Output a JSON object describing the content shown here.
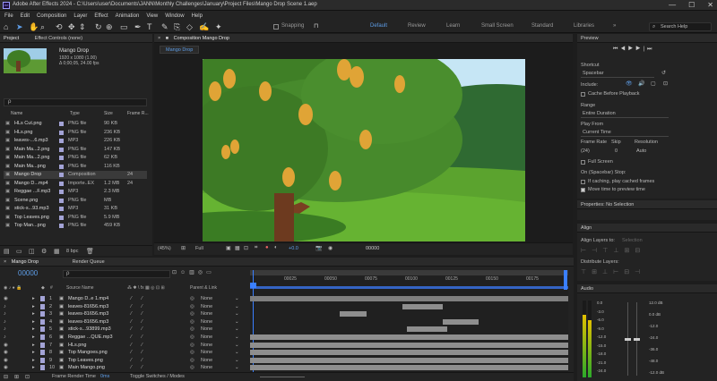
{
  "window": {
    "title": "Adobe After Effects 2024 - C:\\Users\\user\\Documents\\JANN\\Monthly Challenges\\January\\Project Files\\Mango Drop Scene 1.aep"
  },
  "menu": [
    "File",
    "Edit",
    "Composition",
    "Layer",
    "Effect",
    "Animation",
    "View",
    "Window",
    "Help"
  ],
  "toolbar": {
    "snapping": "Snapping",
    "workspaces": [
      "Default",
      "Review",
      "Learn",
      "Small Screen",
      "Standard",
      "Libraries"
    ],
    "active_workspace": "Default",
    "search_placeholder": "Search Help"
  },
  "project": {
    "tabs": [
      "Project",
      "Effect Controls (none)"
    ],
    "preview_name": "Mango Drop",
    "preview_info1": "1920 x 1080 (1.00)",
    "preview_info2": "Δ 0;00;05, 24.00 fps",
    "search_placeholder": "ρ",
    "columns": [
      "Name",
      "Type",
      "Size",
      "Frame R..."
    ],
    "items": [
      {
        "name": "HLs Cut.png",
        "type": "PNG file",
        "size": "90 KB",
        "fr": "",
        "color": "#a3a3d6"
      },
      {
        "name": "HLs.png",
        "type": "PNG file",
        "size": "236 KB",
        "fr": "",
        "color": "#a3a3d6"
      },
      {
        "name": "leaves-...6.mp3",
        "type": "MP3",
        "size": "226 KB",
        "fr": "",
        "color": "#a3a3d6"
      },
      {
        "name": "Main Ma...2.png",
        "type": "PNG file",
        "size": "147 KB",
        "fr": "",
        "color": "#a3a3d6"
      },
      {
        "name": "Main Ma...2.png",
        "type": "PNG file",
        "size": "62 KB",
        "fr": "",
        "color": "#a3a3d6"
      },
      {
        "name": "Main Ma...png",
        "type": "PNG file",
        "size": "116 KB",
        "fr": "",
        "color": "#a3a3d6"
      },
      {
        "name": "Mango Drop",
        "type": "Composition",
        "size": "",
        "fr": "24",
        "color": "#a3a3d6"
      },
      {
        "name": "Mango D...mp4",
        "type": "Importe..EX",
        "size": "1.2 MB",
        "fr": "24",
        "color": "#a3a3d6"
      },
      {
        "name": "Reggae ...F.mp3",
        "type": "MP3",
        "size": "2.3 MB",
        "fr": "",
        "color": "#a3a3d6"
      },
      {
        "name": "Scene.png",
        "type": "PNG file",
        "size": "MB",
        "fr": "",
        "color": "#a3a3d6"
      },
      {
        "name": "stick-s...93.mp3",
        "type": "MP3",
        "size": "31 KB",
        "fr": "",
        "color": "#a3a3d6"
      },
      {
        "name": "Top Leaves.png",
        "type": "PNG file",
        "size": "5.9 MB",
        "fr": "",
        "color": "#a3a3d6"
      },
      {
        "name": "Top Man...png",
        "type": "PNG file",
        "size": "459 KB",
        "fr": "",
        "color": "#a3a3d6"
      }
    ],
    "bpc": "8 bpc"
  },
  "composition": {
    "tab_label": "Composition Mango Drop",
    "subtab": "Mango Drop",
    "zoom": "(45%)",
    "resolution": "Full",
    "exposure": "+0.0",
    "timecode": "00000"
  },
  "timeline": {
    "tabs": [
      "Mango Drop",
      "Render Queue"
    ],
    "current_time": "00000",
    "col_source": "Source Name",
    "col_parent": "Parent & Link",
    "ruler": [
      "00025",
      "00050",
      "00075",
      "00100",
      "00125",
      "00150",
      "00175"
    ],
    "layers": [
      {
        "num": "1",
        "name": "Mango D..e 1.mp4",
        "parent": "None",
        "color": "#a3a3d6"
      },
      {
        "num": "2",
        "name": "leaves-81656.mp3",
        "parent": "None",
        "color": "#a3a3d6"
      },
      {
        "num": "3",
        "name": "leaves-81656.mp3",
        "parent": "None",
        "color": "#a3a3d6"
      },
      {
        "num": "4",
        "name": "leaves-81656.mp3",
        "parent": "None",
        "color": "#a3a3d6"
      },
      {
        "num": "5",
        "name": "stick-s...93899.mp3",
        "parent": "None",
        "color": "#a3a3d6"
      },
      {
        "num": "6",
        "name": "Reggae ...QUE.mp3",
        "parent": "None",
        "color": "#a3a3d6"
      },
      {
        "num": "7",
        "name": "HLs.png",
        "parent": "None",
        "color": "#a3a3d6"
      },
      {
        "num": "8",
        "name": "Top Mangoes.png",
        "parent": "None",
        "color": "#a3a3d6"
      },
      {
        "num": "9",
        "name": "Top Leaves.png",
        "parent": "None",
        "color": "#a3a3d6"
      },
      {
        "num": "10",
        "name": "Main Mango.png",
        "parent": "None",
        "color": "#a3a3d6"
      }
    ],
    "footer_render": "Frame Render Time",
    "footer_render_val": "0ms",
    "footer_toggle": "Toggle Switches / Modes"
  },
  "preview": {
    "title": "Preview",
    "shortcut_label": "Shortcut",
    "shortcut_value": "Spacebar",
    "include_label": "Include:",
    "cache_label": "Cache Before Playback",
    "range_label": "Range",
    "range_value": "Entire Duration",
    "playfrom_label": "Play From",
    "playfrom_value": "Current Time",
    "framerate_label": "Frame Rate",
    "skip_label": "Skip",
    "resolution_label": "Resolution",
    "framerate_value": "(24)",
    "skip_value": "0",
    "resolution_value": "Auto",
    "fullscreen_label": "Full Screen",
    "onstop_label": "On (Spacebar) Stop:",
    "caching_label": "If caching, play cached frames",
    "move_label": "Move time to preview time"
  },
  "properties": {
    "title": "Properties: No Selection"
  },
  "align": {
    "title": "Align",
    "layers_to": "Align Layers to:",
    "layers_to_value": "Selection",
    "distribute": "Distribute Layers:"
  },
  "audio": {
    "title": "Audio",
    "levels": [
      "0.0",
      "-3.0",
      "-6.0",
      "-9.0",
      "-12.0",
      "-15.0",
      "-18.0",
      "-21.0",
      "-24.0"
    ],
    "db_levels": [
      "12.0 dB",
      "0.0 dB",
      "-12.0",
      "-24.0",
      "-36.0",
      "-48.0",
      "-12.0 dB"
    ]
  },
  "colors": {
    "accent": "#2d8ceb",
    "label_lavender": "#a3a3d6",
    "bar_gray": "#8e8e8e",
    "timeline_blue": "#3464c4"
  }
}
